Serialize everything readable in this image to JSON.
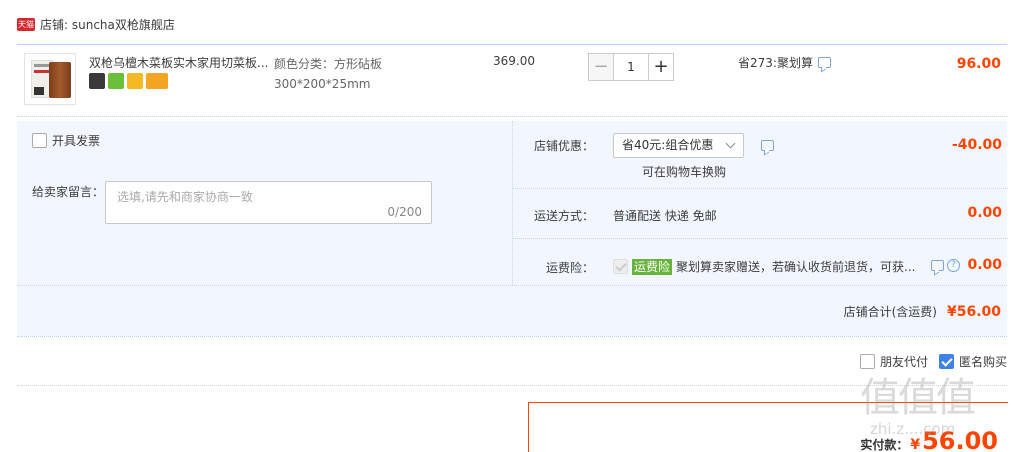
{
  "shop": {
    "badge": "天猫",
    "label": "店铺: suncha双枪旗舰店"
  },
  "item": {
    "title": "双枪乌檀木菜板实木家用切菜板...",
    "sku": "颜色分类：方形砧板300*200*25mm",
    "price": "369.00",
    "quantity": "1",
    "qty_minus": "−",
    "qty_plus": "+",
    "discount": "省273:聚划算",
    "total": "96.00"
  },
  "invoice": {
    "label": "开具发票"
  },
  "message": {
    "label": "给卖家留言：",
    "placeholder": "选填,请先和商家协商一致",
    "count": "0/200"
  },
  "promo": {
    "label": "店铺优惠：",
    "selected": "省40元:组合优惠",
    "sub": "可在购物车换购",
    "amount": "-40.00"
  },
  "shipping": {
    "label": "运送方式：",
    "value": "普通配送 快递 免邮",
    "amount": "0.00"
  },
  "insurance": {
    "label": "运费险：",
    "tag": "运费险",
    "text": "聚划算卖家赠送，若确认收货前退货，可获...",
    "amount": "0.00"
  },
  "shop_total": {
    "label": "店铺合计(含运费)",
    "amount": "¥56.00"
  },
  "options": {
    "friend_pay": "朋友代付",
    "anonymous": "匿名购买"
  },
  "payment": {
    "label": "实付款：",
    "currency": "¥",
    "amount": "56.00"
  },
  "watermark": {
    "big": "值值值",
    "small": "zhi.z....com"
  }
}
